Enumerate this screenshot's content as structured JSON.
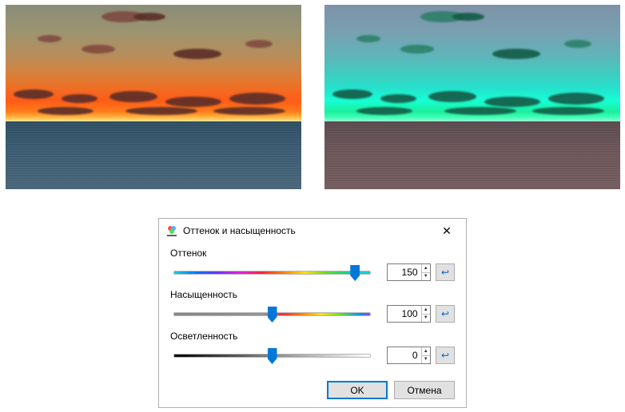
{
  "dialog": {
    "title": "Оттенок и насыщенность",
    "labels": {
      "hue": "Оттенок",
      "saturation": "Насыщенность",
      "lightness": "Осветленность"
    },
    "values": {
      "hue": "150",
      "saturation": "100",
      "lightness": "0"
    },
    "slider_pct": {
      "hue": 92,
      "saturation": 50,
      "lightness": 50
    },
    "buttons": {
      "ok": "OK",
      "cancel": "Отмена"
    },
    "reset_glyph": "↩",
    "close_glyph": "✕",
    "spin_up": "▲",
    "spin_down": "▼"
  },
  "images": {
    "left_desc": "sunset-original",
    "right_desc": "sunset-hue-shifted"
  }
}
